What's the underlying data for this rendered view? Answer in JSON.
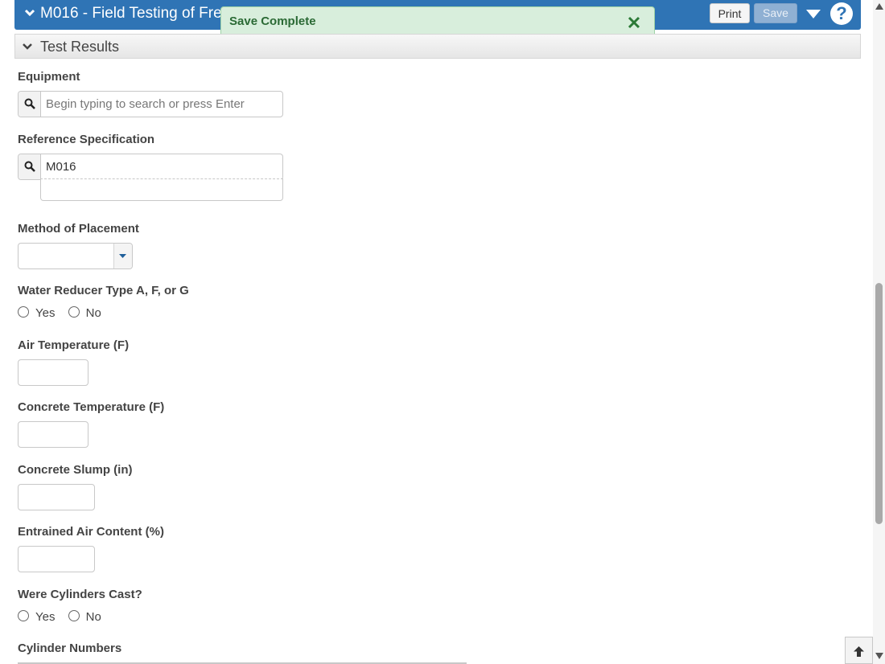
{
  "header": {
    "title": "M016 - Field Testing of Fres",
    "print_label": "Print",
    "save_label": "Save",
    "help_label": "?"
  },
  "toast": {
    "message": "Save Complete"
  },
  "section": {
    "title": "Test Results"
  },
  "form": {
    "equipment": {
      "label": "Equipment",
      "placeholder": "Begin typing to search or press Enter",
      "value": ""
    },
    "reference_spec": {
      "label": "Reference Specification",
      "value": "M016"
    },
    "method_of_placement": {
      "label": "Method of Placement",
      "selected": ""
    },
    "water_reducer": {
      "label": "Water Reducer Type A, F, or G",
      "options": [
        "Yes",
        "No"
      ]
    },
    "air_temperature": {
      "label": "Air Temperature (F)",
      "value": ""
    },
    "concrete_temperature": {
      "label": "Concrete Temperature (F)",
      "value": ""
    },
    "concrete_slump": {
      "label": "Concrete Slump (in)",
      "value": ""
    },
    "entrained_air": {
      "label": "Entrained Air Content (%)",
      "value": ""
    },
    "cylinders_cast": {
      "label": "Were Cylinders Cast?",
      "options": [
        "Yes",
        "No"
      ]
    },
    "cylinder_numbers": {
      "label": "Cylinder Numbers"
    }
  },
  "colors": {
    "header_bg": "#2f74b5",
    "toast_bg": "#d8eedc",
    "toast_text": "#2b6a35"
  }
}
